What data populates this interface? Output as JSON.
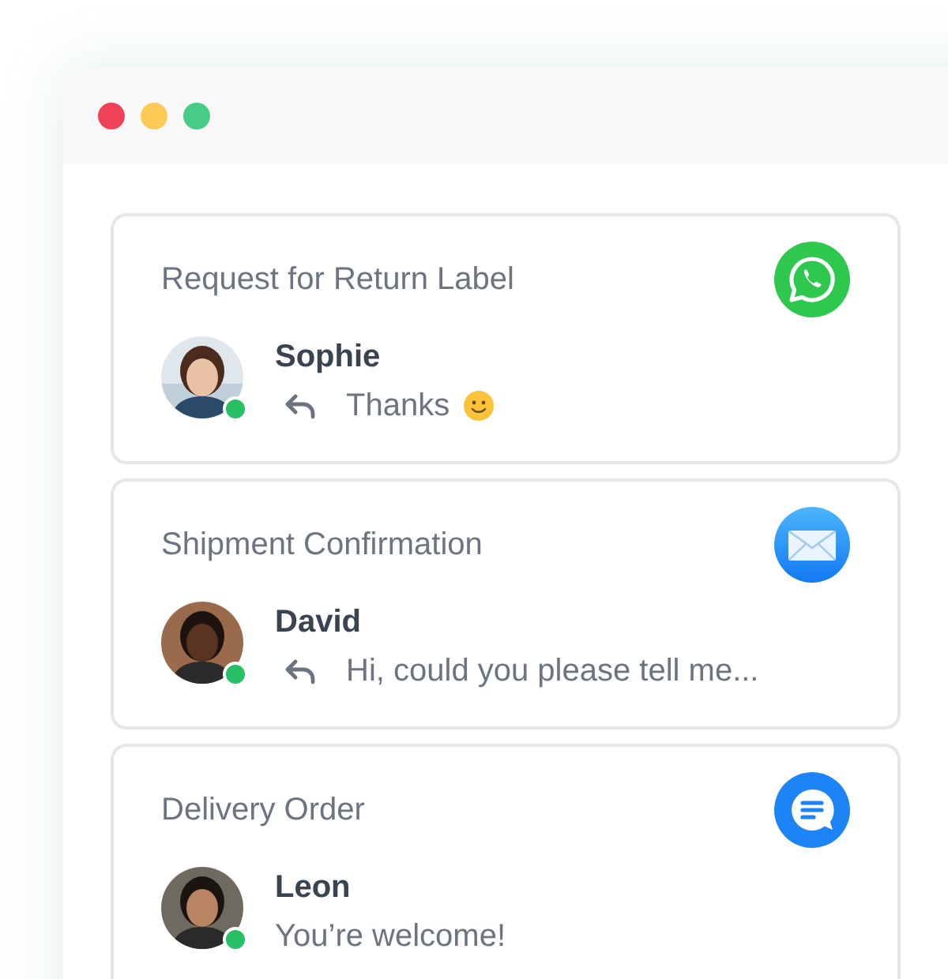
{
  "window": {
    "controls": [
      {
        "color": "#f04256"
      },
      {
        "color": "#ffc955"
      },
      {
        "color": "#47cc85"
      }
    ]
  },
  "conversations": [
    {
      "subject": "Request for Return Label",
      "kind": "whatsapp",
      "name": "Sophie",
      "online": true,
      "replied": true,
      "message": "Thanks",
      "emoji": true
    },
    {
      "subject": "Shipment Confirmation",
      "kind": "email",
      "name": "David",
      "online": true,
      "replied": true,
      "message": "Hi, could you please tell me...",
      "emoji": false
    },
    {
      "subject": "Delivery Order",
      "kind": "chat",
      "name": "Leon",
      "online": true,
      "replied": false,
      "message": "You’re welcome!",
      "emoji": false
    }
  ]
}
